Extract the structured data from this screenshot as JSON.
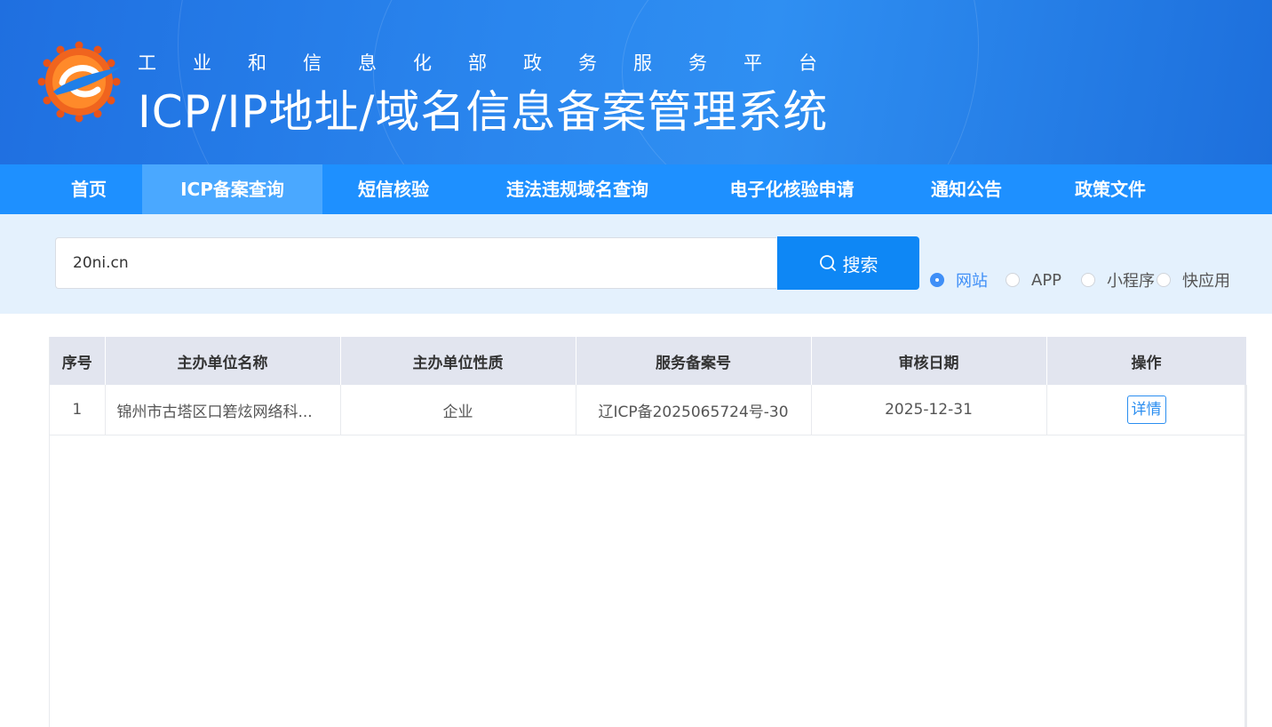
{
  "header": {
    "subtitle": "工业和信息化部政务服务平台",
    "title": "ICP/IP地址/域名信息备案管理系统",
    "logo_icon": "miit-gear-e-logo",
    "colors": {
      "header_blue": "#2a86ee",
      "logo_orange": "#f0641e"
    }
  },
  "nav": {
    "items": [
      {
        "label": "首页",
        "active": false
      },
      {
        "label": "ICP备案查询",
        "active": true
      },
      {
        "label": "短信核验",
        "active": false
      },
      {
        "label": "违法违规域名查询",
        "active": false
      },
      {
        "label": "电子化核验申请",
        "active": false
      },
      {
        "label": "通知公告",
        "active": false
      },
      {
        "label": "政策文件",
        "active": false
      }
    ],
    "colors": {
      "bar": "#1e90ff",
      "active": "#4aa8ff"
    }
  },
  "search": {
    "value": "20ni.cn",
    "button_label": "搜索",
    "button_icon": "search-icon",
    "options": [
      {
        "label": "网站",
        "checked": true
      },
      {
        "label": "APP",
        "checked": false
      },
      {
        "label": "小程序",
        "checked": false
      },
      {
        "label": "快应用",
        "checked": false
      }
    ]
  },
  "table": {
    "headers": [
      "序号",
      "主办单位名称",
      "主办单位性质",
      "服务备案号",
      "审核日期",
      "操作"
    ],
    "rows": [
      {
        "index": "1",
        "org_name": "锦州市古塔区口箬炫网络科...",
        "org_type": "企业",
        "record_no": "辽ICP备2025065724号-30",
        "review_date": "2025-12-31",
        "action": "详情"
      }
    ]
  }
}
